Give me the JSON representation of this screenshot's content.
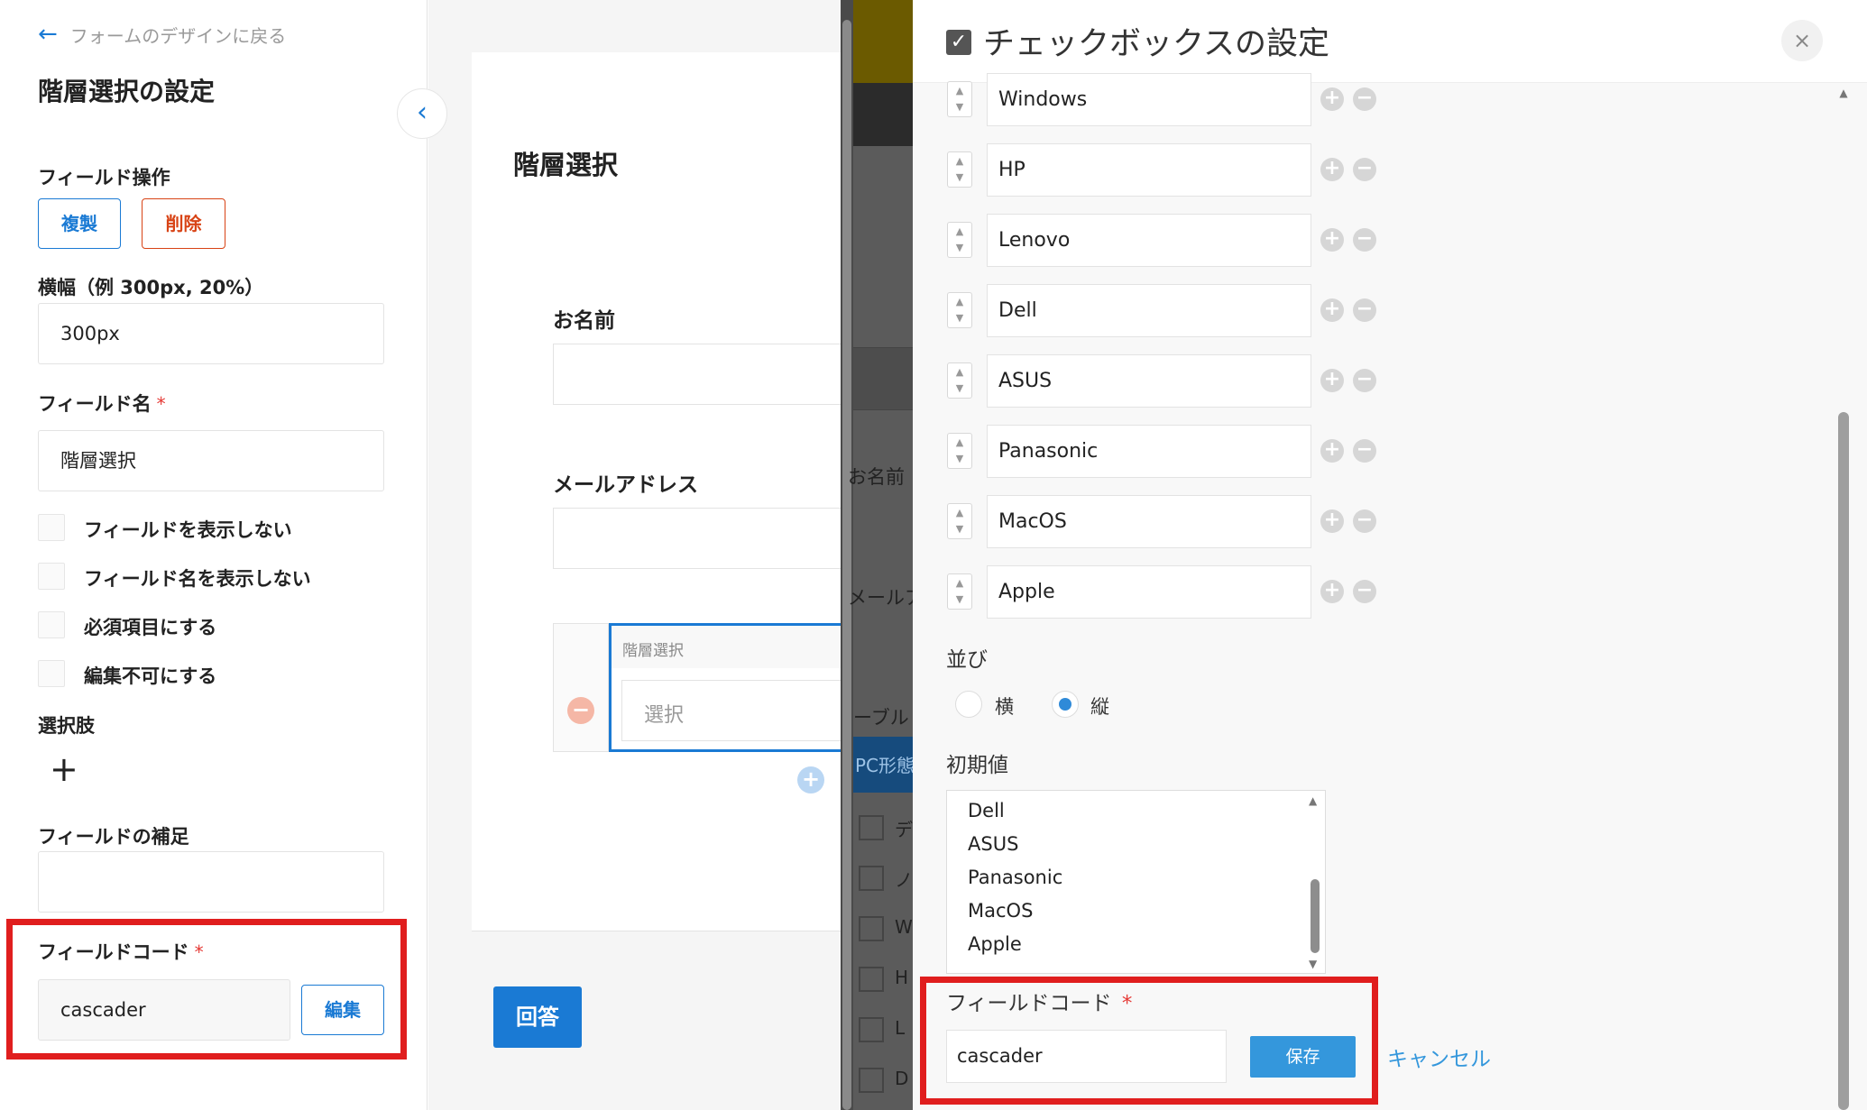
{
  "left": {
    "back_label": "フォームのデザインに戻る",
    "title": "階層選択の設定",
    "field_ops_label": "フィールド操作",
    "duplicate_label": "複製",
    "delete_label": "削除",
    "width_label": "横幅（例 300px, 20%）",
    "width_value": "300px",
    "field_name_label": "フィールド名",
    "required_mark": "*",
    "field_name_value": "階層選択",
    "checkboxes": [
      "フィールドを表示しない",
      "フィールド名を表示しない",
      "必須項目にする",
      "編集不可にする"
    ],
    "choices_label": "選択肢",
    "add_symbol": "+",
    "supplement_label": "フィールドの補足",
    "supplement_value": "",
    "field_code_label": "フィールドコード",
    "field_code_value": "cascader",
    "edit_label": "編集"
  },
  "middle": {
    "form_title": "階層選択",
    "name_label": "お名前",
    "email_label": "メールアドレス",
    "table_header": "階層選択",
    "select_placeholder": "選択",
    "answer_label": "回答"
  },
  "background_partial": {
    "name_label": "お名前",
    "mail_label": "メールア",
    "table_label": "ーブル",
    "pc_label": "PC形態",
    "list_chars": [
      "デ",
      "ノ",
      "W",
      "H",
      "L",
      "D"
    ]
  },
  "panel": {
    "title": "チェックボックスの設定",
    "close_symbol": "×",
    "options": [
      "Windows",
      "HP",
      "Lenovo",
      "Dell",
      "ASUS",
      "Panasonic",
      "MacOS",
      "Apple"
    ],
    "layout_label": "並び",
    "layout_horizontal": "横",
    "layout_vertical": "縦",
    "layout_selected": "縦",
    "default_label": "初期値",
    "default_list": [
      "Dell",
      "ASUS",
      "Panasonic",
      "MacOS",
      "Apple"
    ],
    "field_code_label": "フィールドコード",
    "required_mark": "*",
    "field_code_value": "cascader",
    "save_label": "保存",
    "cancel_label": "キャンセル"
  },
  "colors": {
    "accent": "#1a7ad4",
    "delete": "#d84315",
    "highlight": "#e01e1e",
    "banner": "#6b5a00"
  }
}
